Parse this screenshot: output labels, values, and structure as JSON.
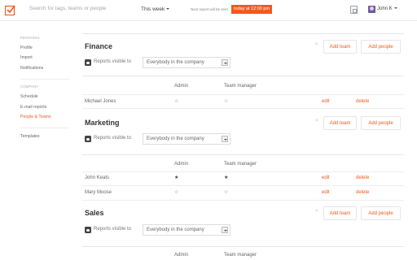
{
  "topbar": {
    "search_placeholder": "Search for tags, teams or people",
    "week_label": "This week",
    "next_report_label": "Next report will be sent",
    "next_report_value": "today at 12:00 pm",
    "user_name": "John K"
  },
  "sidebar": {
    "personal_header": "PERSONAL",
    "personal_items": [
      "Profile",
      "Import",
      "Notifications"
    ],
    "company_header": "COMPANY",
    "company_items": [
      "Schedule",
      "E-mail reports",
      "People & Teams"
    ],
    "active_item": "People & Teams",
    "templates": "Templates"
  },
  "labels": {
    "reports_visible_to": "Reports visible to",
    "admin": "Admin",
    "team_manager": "Team manager",
    "add_team": "Add team",
    "add_people": "Add people",
    "edit": "edit",
    "delete": "delete",
    "close": "×"
  },
  "teams": [
    {
      "name": "Finance",
      "visibility": "Everybody in the company",
      "members": [
        {
          "name": "Michael Jones",
          "admin": false,
          "manager": false
        }
      ]
    },
    {
      "name": "Marketing",
      "visibility": "Everybody in the company",
      "members": [
        {
          "name": "John Keats",
          "admin": true,
          "manager": true
        },
        {
          "name": "Mary Moose",
          "admin": false,
          "manager": false
        }
      ]
    },
    {
      "name": "Sales",
      "visibility": "Everybody in the company",
      "members": []
    }
  ],
  "colors": {
    "accent": "#f05a1e",
    "text": "#555555"
  }
}
